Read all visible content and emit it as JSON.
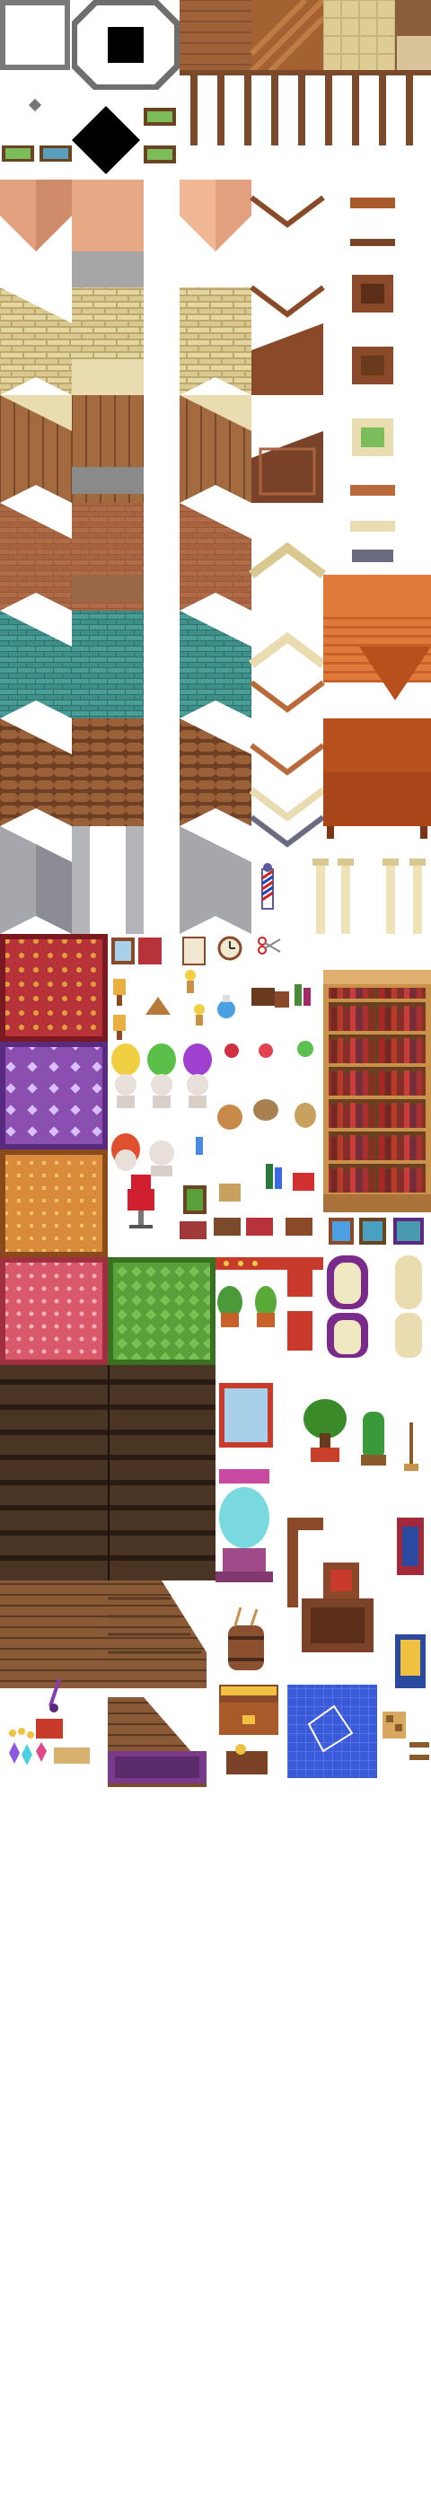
{
  "sheet": {
    "background": "#ffffff",
    "palette": {
      "skin_wall": "#e2a07e",
      "stone_wall": "#d9c990",
      "brick_wall": "#9a5a3a",
      "teal_brick": "#3e8f8a",
      "log_wall": "#8e5530",
      "grey_wall": "#a6a6ad",
      "rug_red": "#b8323a",
      "rug_purple": "#8a4fb0",
      "rug_orange": "#d98a3b",
      "rug_pink": "#d9596a",
      "rug_green": "#5aa03a",
      "dark_floor": "#3a2a1e",
      "wood_floor": "#8a5a36",
      "bookshelf": "#9a6a3a",
      "pillar": "#f0e2b8",
      "roof_orange": "#e07a3a",
      "blueprint": "#3a5ad9"
    },
    "icons": [
      "autotile-white-icon",
      "autotile-octagon-icon",
      "small-diamond-icon",
      "black-diamond-icon",
      "painting-icon",
      "wood-floor-icon",
      "tile-floor-icon",
      "fence-post-icon",
      "barber-pole-icon",
      "scissors-icon",
      "clock-icon",
      "mirror-icon",
      "potion-icon",
      "lamp-icon",
      "candle-icon",
      "bust-icon",
      "wig-icon",
      "barber-chair-icon",
      "sack-icon",
      "jar-icon",
      "bottle-icon",
      "plant-icon",
      "bonsai-icon",
      "cactus-icon",
      "broom-icon",
      "window-icon",
      "curtain-icon",
      "banner-icon",
      "barrel-icon",
      "treasure-chest-icon",
      "blueprint-icon",
      "map-icon",
      "crystal-icon",
      "quill-icon",
      "coins-icon",
      "stairs-icon",
      "bookshelf-icon",
      "pillar-icon",
      "table-icon",
      "lantern-icon"
    ]
  }
}
